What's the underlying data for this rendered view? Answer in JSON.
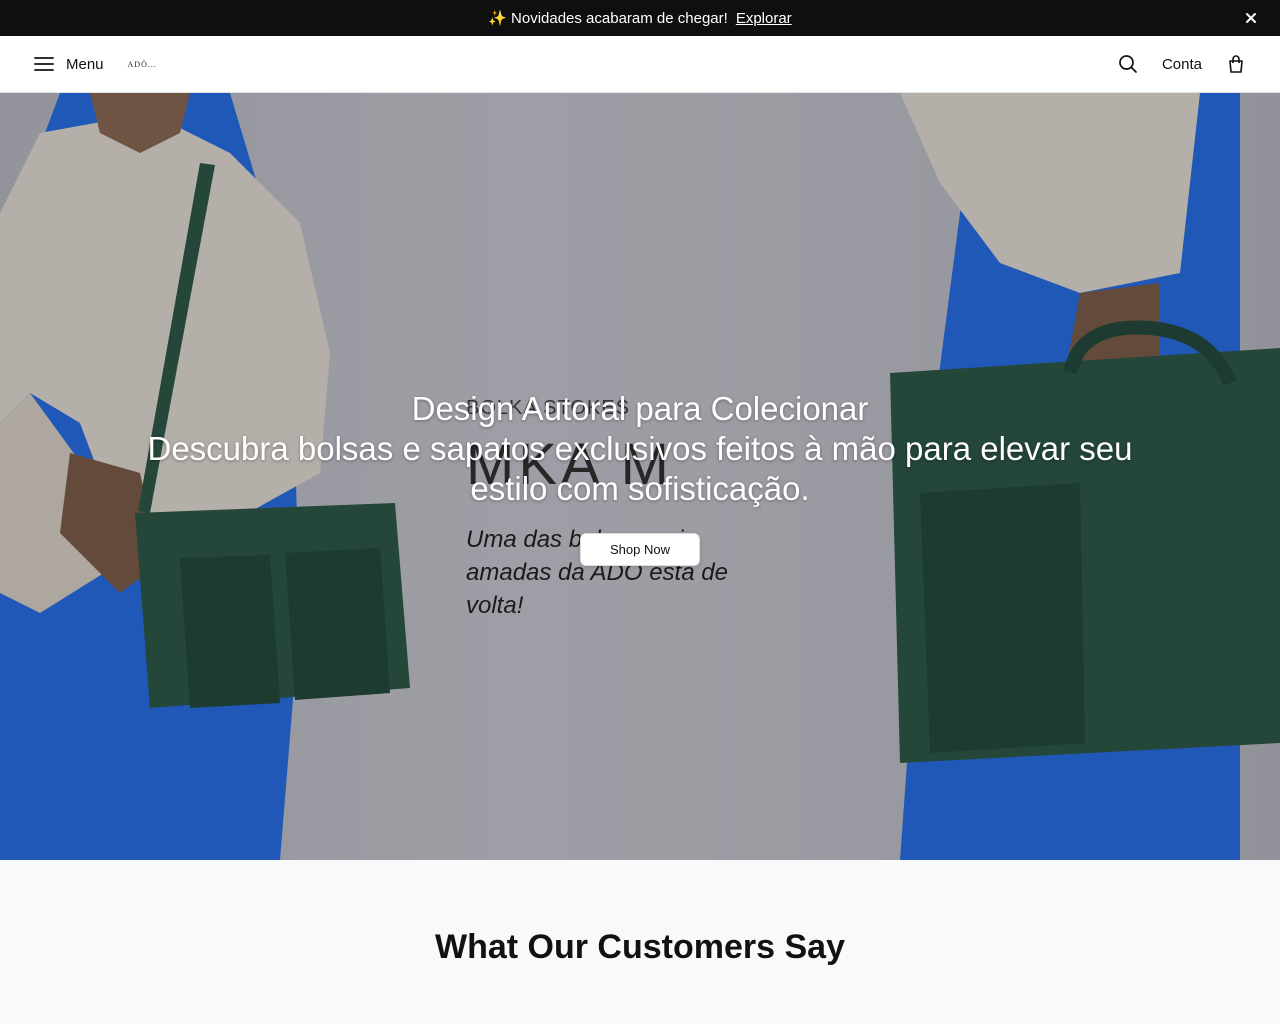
{
  "announcement": {
    "emoji": "✨",
    "text": "Novidades acabaram de chegar!",
    "link": "Explorar"
  },
  "header": {
    "menu_label": "Menu",
    "logo_text": "ADÒ...",
    "account_label": "Conta"
  },
  "hero": {
    "title": "Design Autoral para Colecionar",
    "subtitle": "Descubra bolsas e sapatos exclusivos feitos à mão para elevar seu estilo com sofisticação.",
    "cta": "Shop Now",
    "poster": {
      "brand": "BOLKA STOKES",
      "name": "MKA M",
      "tagline": "Uma das bolsas mais amadas da ADO está de volta!"
    }
  },
  "reviews": {
    "heading": "What Our Customers Say"
  },
  "colors": {
    "announcement_bg": "#0f0f0f",
    "bag_green": "#1f4a36",
    "dress_blue": "#1a5fd0"
  }
}
